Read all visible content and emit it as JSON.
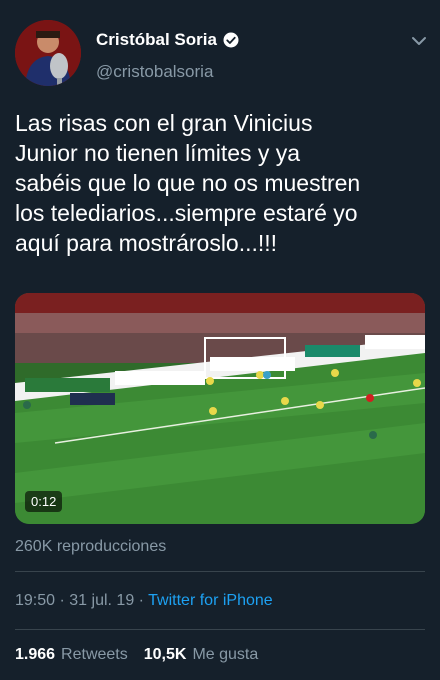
{
  "author": {
    "display_name": "Cristóbal Soria",
    "handle": "@cristobalsoria",
    "verified_icon": "verified-badge-icon",
    "avatar_icon": "avatar"
  },
  "menu_icon": "chevron-down-icon",
  "tweet": {
    "text": "Las risas con el gran Vinicius\nJunior no tienen límites y ya\nsabéis que lo que no os muestren\nlos telediarios...siempre estaré yo\naquí para mostrároslo...!!!"
  },
  "media": {
    "duration": "0:12",
    "views": "260K reproducciones"
  },
  "meta": {
    "time": "19:50",
    "separator": "·",
    "date": "31 jul. 19",
    "source": "Twitter for iPhone"
  },
  "stats": {
    "retweets_count": "1.966",
    "retweets_label": "Retweets",
    "likes_count": "10,5K",
    "likes_label": "Me gusta"
  },
  "colors": {
    "background": "#15202b",
    "secondary_text": "#8899a6",
    "accent": "#1da1f2",
    "divider": "#38444d"
  }
}
